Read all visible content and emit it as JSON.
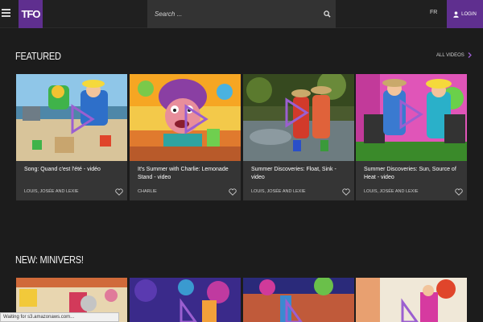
{
  "header": {
    "logo": "TFO",
    "search_placeholder": "Search ...",
    "language": "FR",
    "login_label": "LOGIN"
  },
  "colors": {
    "accent": "#5f2f8f",
    "play_icon": "#9b5fd0",
    "background": "#1c1c1c",
    "card": "#353535"
  },
  "featured": {
    "title": "FEATURED",
    "all_videos": "ALL VIDEOS",
    "cards": [
      {
        "title": "Song: Quand c'est l'été - vidéo",
        "subtitle": "LOUIS, JOSÉE AND LEXIE"
      },
      {
        "title": "It's Summer with Charlie: Lemonade Stand - video",
        "subtitle": "CHARLIE"
      },
      {
        "title": "Summer Discoveries: Float, Sink - video",
        "subtitle": "LOUIS, JOSÉE AND LEXIE"
      },
      {
        "title": "Summer Discoveries: Sun, Source of Heat - video",
        "subtitle": "LOUIS, JOSÉE AND LEXIE"
      }
    ]
  },
  "minivers": {
    "title": "NEW: MINIVERS!"
  },
  "status_bar": "Waiting for s3.amazonaws.com..."
}
